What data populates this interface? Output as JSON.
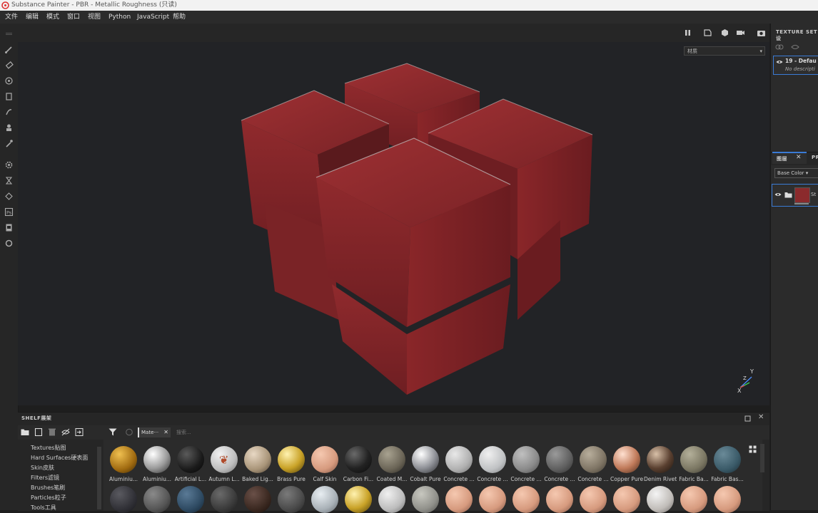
{
  "window": {
    "title": "Substance Painter - PBR - Metallic Roughness (只读)"
  },
  "menu": {
    "items": [
      "文件",
      "编辑",
      "模式",
      "窗口",
      "视图",
      "Python",
      "JavaScript",
      "帮助"
    ]
  },
  "viewport": {
    "material_select": "材质",
    "axis_x": "X",
    "axis_y": "Y",
    "axis_z": "Z"
  },
  "texture_set": {
    "header": "TEXTURE SET设",
    "item_label": "19 - Defau",
    "item_desc": "No descripti"
  },
  "layers": {
    "tab_label": "图层",
    "tab2_label": "PR",
    "channel_select": "Base Color",
    "layer_name": "St"
  },
  "shelf": {
    "title": "SHELF展架",
    "search_tag": "Mate···",
    "search_placeholder": "搜索...",
    "categories": [
      "Textures贴图",
      "Hard Surfaces硬表面",
      "Skin皮肤",
      "Filters滤镜",
      "Brushes笔刷",
      "Particles粒子",
      "Tools工具"
    ],
    "materials_row1": [
      "Aluminiu...",
      "Aluminiu...",
      "Artificial L...",
      "Autumn L...",
      "Baked Lig...",
      "Brass Pure",
      "Calf Skin",
      "Carbon Fi...",
      "Coated M...",
      "Cobalt Pure",
      "Concrete ...",
      "Concrete ...",
      "Concrete ...",
      "Concrete ...",
      "Concrete ...",
      "Copper Pure",
      "Denim Rivet",
      "Fabric Ba...",
      "Fabric Bas..."
    ]
  },
  "colors": {
    "accent": "#3a7bd5",
    "cube_red": "#8b2a2c",
    "panel": "#2b2b2b"
  }
}
